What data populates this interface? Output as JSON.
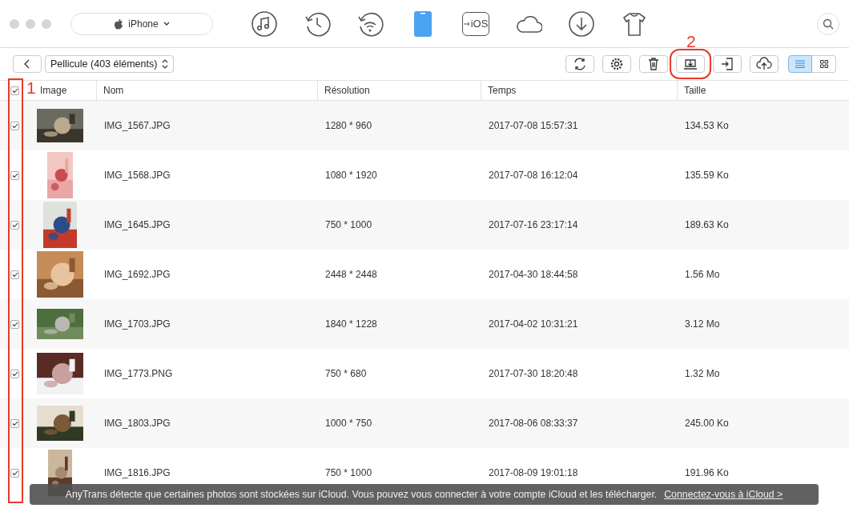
{
  "device_selector": {
    "label": "iPhone"
  },
  "nav": [
    {
      "kind": "music",
      "selected": false
    },
    {
      "kind": "history",
      "selected": false
    },
    {
      "kind": "wifi",
      "selected": false
    },
    {
      "kind": "phone",
      "selected": true
    },
    {
      "kind": "ios",
      "label": "iOS",
      "selected": false
    },
    {
      "kind": "cloud",
      "selected": false
    },
    {
      "kind": "download",
      "selected": false
    },
    {
      "kind": "shirt",
      "selected": false
    }
  ],
  "album_selector": {
    "label": "Pellicule (403 éléments)"
  },
  "toolbar": [
    {
      "kind": "refresh"
    },
    {
      "kind": "settings"
    },
    {
      "kind": "delete"
    },
    {
      "kind": "export",
      "highlighted": true
    },
    {
      "kind": "import"
    },
    {
      "kind": "upload"
    }
  ],
  "view_toggle": [
    {
      "kind": "list",
      "selected": true
    },
    {
      "kind": "grid",
      "selected": false
    }
  ],
  "annotations": [
    {
      "label": "1"
    },
    {
      "label": "2"
    }
  ],
  "table": {
    "all_checked": true,
    "columns": [
      "Image",
      "Nom",
      "Résolution",
      "Temps",
      "Taille"
    ],
    "rows": [
      {
        "checked": true,
        "name": "IMG_1567.JPG",
        "resolution": "1280 * 960",
        "time": "2017-07-08 15:57:31",
        "size": "134.53 Ko"
      },
      {
        "checked": true,
        "name": "IMG_1568.JPG",
        "resolution": "1080 * 1920",
        "time": "2017-07-08 16:12:04",
        "size": "135.59 Ko"
      },
      {
        "checked": true,
        "name": "IMG_1645.JPG",
        "resolution": "750 * 1000",
        "time": "2017-07-16 23:17:14",
        "size": "189.63 Ko"
      },
      {
        "checked": true,
        "name": "IMG_1692.JPG",
        "resolution": "2448 * 2448",
        "time": "2017-04-30 18:44:58",
        "size": "1.56 Mo"
      },
      {
        "checked": true,
        "name": "IMG_1703.JPG",
        "resolution": "1840 * 1228",
        "time": "2017-04-02 10:31:21",
        "size": "3.12 Mo"
      },
      {
        "checked": true,
        "name": "IMG_1773.PNG",
        "resolution": "750 * 680",
        "time": "2017-07-30 18:20:48",
        "size": "1.32 Mo"
      },
      {
        "checked": true,
        "name": "IMG_1803.JPG",
        "resolution": "1000 * 750",
        "time": "2017-08-06 08:33:37",
        "size": "245.00 Ko"
      },
      {
        "checked": true,
        "name": "IMG_1816.JPG",
        "resolution": "750 * 1000",
        "time": "2017-08-09 19:01:18",
        "size": "191.96 Ko"
      }
    ]
  },
  "notice": {
    "text": "AnyTrans détecte que certaines photos sont stockées sur iCloud. Vous pouvez vous connecter à votre compte iCloud et les télécharger.",
    "link": "Connectez-vous à iCloud >"
  }
}
